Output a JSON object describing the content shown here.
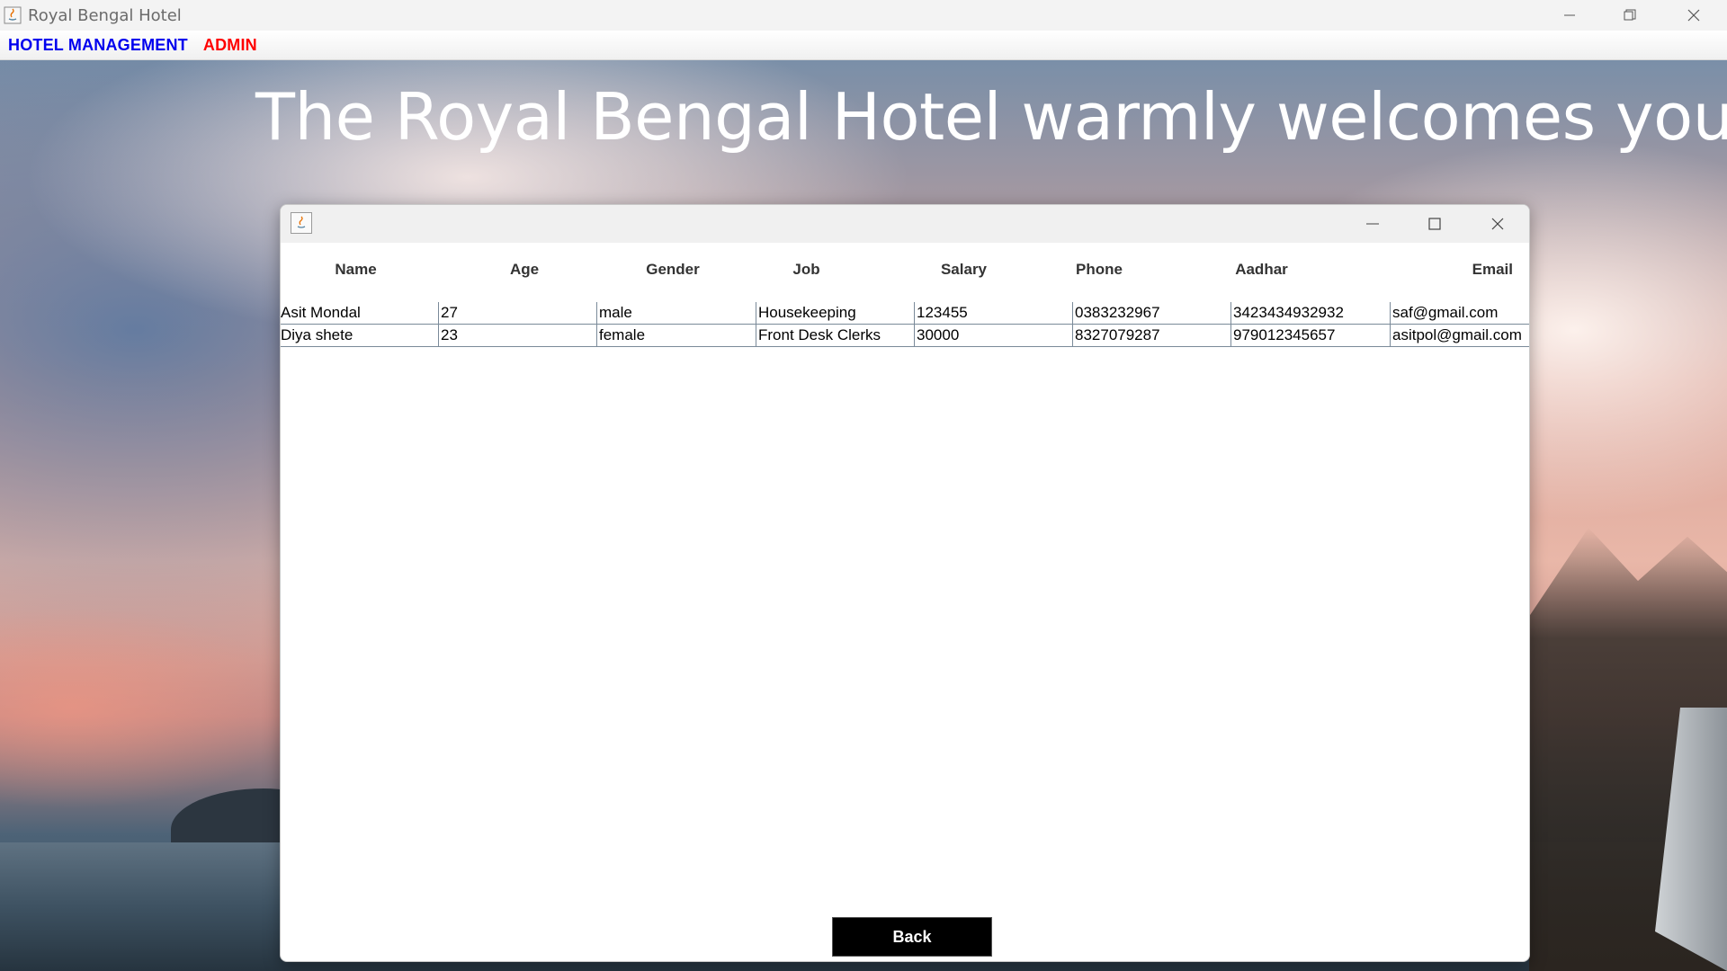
{
  "window": {
    "title": "Royal Bengal Hotel"
  },
  "menubar": {
    "items": [
      {
        "label": "HOTEL MANAGEMENT",
        "color": "#0000ee"
      },
      {
        "label": "ADMIN",
        "color": "#ff0000"
      }
    ]
  },
  "welcome_text": "The Royal Bengal Hotel warmly welcomes you.",
  "table": {
    "columns": [
      "Name",
      "Age",
      "Gender",
      "Job",
      "Salary",
      "Phone",
      "Aadhar",
      "Email"
    ],
    "rows": [
      [
        "Asit Mondal",
        "27",
        "male",
        "Housekeeping",
        "123455",
        "0383232967",
        "3423434932932",
        "saf@gmail.com"
      ],
      [
        "Diya shete",
        "23",
        "female",
        "Front Desk Clerks",
        "30000",
        "8327079287",
        "979012345657",
        "asitpol@gmail.com"
      ]
    ]
  },
  "back_button": {
    "label": "Back"
  }
}
